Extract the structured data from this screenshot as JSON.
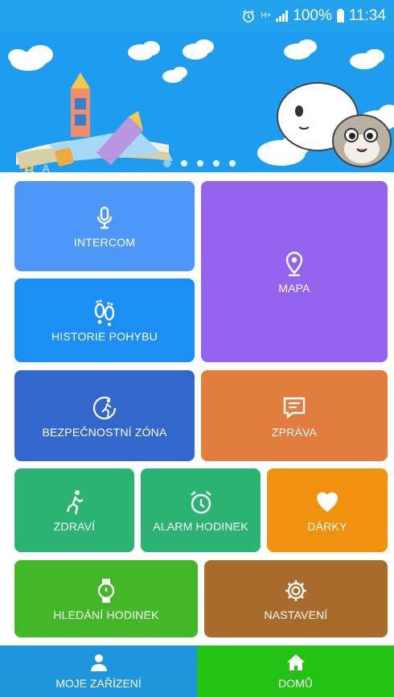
{
  "status_bar": {
    "battery_percent": "100%",
    "time": "11:34",
    "network_label": "H+",
    "icons": [
      "alarm-icon",
      "network-type-icon",
      "signal-icon",
      "battery-icon"
    ]
  },
  "banner": {
    "slide_count": 5,
    "active_slide": 1,
    "text_letters": [
      "B",
      "A"
    ]
  },
  "tiles": {
    "intercom": {
      "label": "INTERCOM",
      "icon": "microphone-icon"
    },
    "historie": {
      "label": "HISTORIE POHYBU",
      "icon": "footprints-icon"
    },
    "mapa": {
      "label": "MAPA",
      "icon": "map-pin-icon"
    },
    "zona": {
      "label": "BEZPEČNOSTNÍ ZÓNA",
      "icon": "safe-zone-icon"
    },
    "zprava": {
      "label": "ZPRÁVA",
      "icon": "message-icon"
    },
    "zdravi": {
      "label": "ZDRAVÍ",
      "icon": "running-icon"
    },
    "alarm": {
      "label": "ALARM HODINEK",
      "icon": "alarm-clock-icon"
    },
    "darky": {
      "label": "DÁRKY",
      "icon": "heart-icon"
    },
    "hledani": {
      "label": "HLEDÁNÍ HODINEK",
      "icon": "watch-icon"
    },
    "nastaveni": {
      "label": "NASTAVENÍ",
      "icon": "gear-icon"
    }
  },
  "bottom_nav": {
    "devices_label": "MOJE ZAŘÍZENÍ",
    "home_label": "DOMŮ"
  },
  "colors": {
    "status_bar": "#22a2ec",
    "banner": "#1e9cf0",
    "intercom": "#4d97f8",
    "historie": "#1c8ff5",
    "mapa": "#9463ee",
    "zona": "#3367cc",
    "zprava": "#e27d3f",
    "zdravi": "#2bb374",
    "alarm": "#2bb374",
    "darky": "#f0920e",
    "hledani": "#44b729",
    "nastaveni": "#a96b2b",
    "nav_devices": "#1e95dc",
    "nav_home": "#25c216"
  }
}
